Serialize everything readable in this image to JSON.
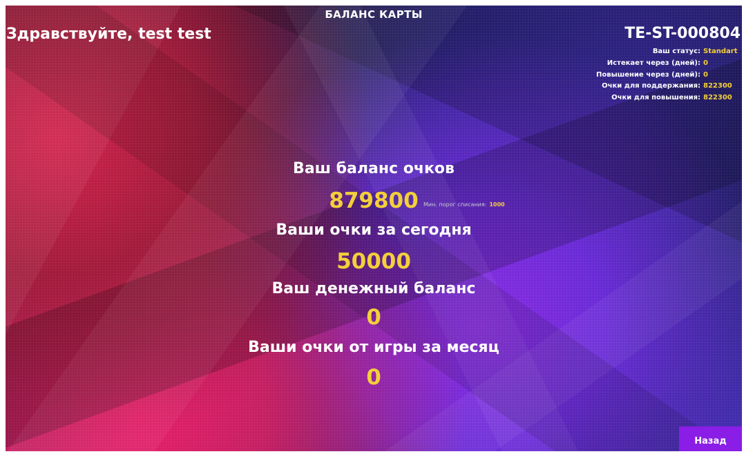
{
  "header": {
    "title": "БАЛАНС КАРТЫ",
    "greeting": "Здравствуйте, test test"
  },
  "card": {
    "id": "TE-ST-000804",
    "details": [
      {
        "label": "Ваш статус:",
        "value": "Standart"
      },
      {
        "label": "Истекает через (дней):",
        "value": "0"
      },
      {
        "label": "Повышение через (дней):",
        "value": "0"
      },
      {
        "label": "Очки для поддержания:",
        "value": "822300"
      },
      {
        "label": "Очки для повышения:",
        "value": "822300"
      }
    ]
  },
  "balances": {
    "points_label": "Ваш баланс очков",
    "points_value": "879800",
    "min_threshold_label": "Мин. порог списания:",
    "min_threshold_value": "1000",
    "today_label": "Ваши очки за сегодня",
    "today_value": "50000",
    "money_label": "Ваш денежный баланс",
    "money_value": "0",
    "monthly_label": "Ваши очки от игры за месяц",
    "monthly_value": "0"
  },
  "actions": {
    "back_label": "Назад"
  },
  "colors": {
    "accent_yellow": "#f3d03a",
    "button_purple": "#8a1ee6"
  }
}
